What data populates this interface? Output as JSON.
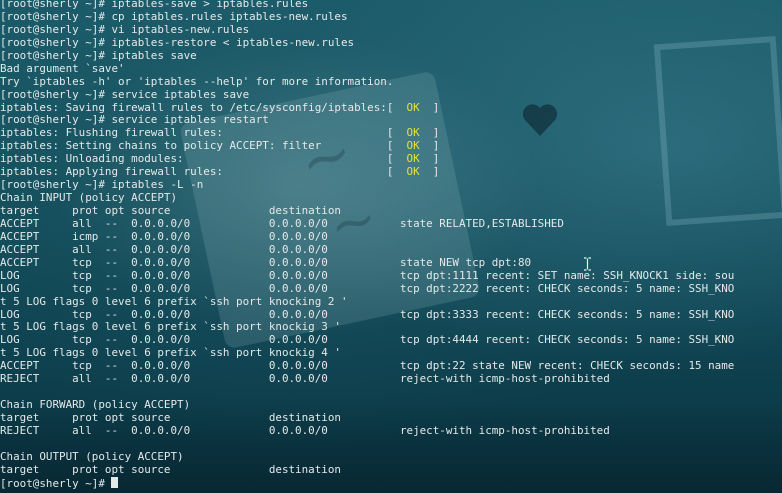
{
  "icons": {
    "text_cursor": "i-beam-cursor-icon",
    "block_cursor": "block-cursor"
  },
  "colors": {
    "ok": "#e2e23a",
    "text": "#e4e9e9"
  },
  "terminal": {
    "lines": [
      [
        {
          "t": "[root@sherly ~]# iptables-save > iptables.rules"
        }
      ],
      [
        {
          "t": "[root@sherly ~]# cp iptables.rules iptables-new.rules"
        }
      ],
      [
        {
          "t": "[root@sherly ~]# vi iptables-new.rules"
        }
      ],
      [
        {
          "t": "[root@sherly ~]# iptables-restore < iptables-new.rules"
        }
      ],
      [
        {
          "t": "[root@sherly ~]# iptables save"
        }
      ],
      [
        {
          "t": "Bad argument `save'"
        }
      ],
      [
        {
          "t": "Try `iptables -h' or 'iptables --help' for more information."
        }
      ],
      [
        {
          "t": "[root@sherly ~]# service iptables save"
        }
      ],
      [
        {
          "t": "iptables: Saving firewall rules to /etc/sysconfig/iptables:[  "
        },
        {
          "t": "OK",
          "ok": true
        },
        {
          "t": "  ]"
        }
      ],
      [
        {
          "t": "[root@sherly ~]# service iptables restart"
        }
      ],
      [
        {
          "t": "iptables: Flushing firewall rules:                         [  "
        },
        {
          "t": "OK",
          "ok": true
        },
        {
          "t": "  ]"
        }
      ],
      [
        {
          "t": "iptables: Setting chains to policy ACCEPT: filter          [  "
        },
        {
          "t": "OK",
          "ok": true
        },
        {
          "t": "  ]"
        }
      ],
      [
        {
          "t": "iptables: Unloading modules:                               [  "
        },
        {
          "t": "OK",
          "ok": true
        },
        {
          "t": "  ]"
        }
      ],
      [
        {
          "t": "iptables: Applying firewall rules:                         [  "
        },
        {
          "t": "OK",
          "ok": true
        },
        {
          "t": "  ]"
        }
      ],
      [
        {
          "t": "[root@sherly ~]# iptables -L -n"
        }
      ],
      [
        {
          "t": "Chain INPUT (policy ACCEPT)"
        }
      ],
      [
        {
          "t": "target     prot opt source               destination"
        }
      ],
      [
        {
          "t": "ACCEPT     all  --  0.0.0.0/0            0.0.0.0/0           state RELATED,ESTABLISHED"
        }
      ],
      [
        {
          "t": "ACCEPT     icmp --  0.0.0.0/0            0.0.0.0/0"
        }
      ],
      [
        {
          "t": "ACCEPT     all  --  0.0.0.0/0            0.0.0.0/0"
        }
      ],
      [
        {
          "t": "ACCEPT     tcp  --  0.0.0.0/0            0.0.0.0/0           state NEW tcp dpt:80"
        }
      ],
      [
        {
          "t": "LOG        tcp  --  0.0.0.0/0            0.0.0.0/0           tcp dpt:1111 recent: SET name: SSH_KNOCK1 side: sou"
        }
      ],
      [
        {
          "t": "LOG        tcp  --  0.0.0.0/0            0.0.0.0/0           tcp dpt:2222 recent: CHECK seconds: 5 name: SSH_KNO"
        }
      ],
      [
        {
          "t": "t 5 LOG flags 0 level 6 prefix `ssh port knocking 2 '"
        }
      ],
      [
        {
          "t": "LOG        tcp  --  0.0.0.0/0            0.0.0.0/0           tcp dpt:3333 recent: CHECK seconds: 5 name: SSH_KNO"
        }
      ],
      [
        {
          "t": "t 5 LOG flags 0 level 6 prefix `ssh port knockig 3 '"
        }
      ],
      [
        {
          "t": "LOG        tcp  --  0.0.0.0/0            0.0.0.0/0           tcp dpt:4444 recent: CHECK seconds: 5 name: SSH_KNO"
        }
      ],
      [
        {
          "t": "t 5 LOG flags 0 level 6 prefix `ssh port knockig 4 '"
        }
      ],
      [
        {
          "t": "ACCEPT     tcp  --  0.0.0.0/0            0.0.0.0/0           tcp dpt:22 state NEW recent: CHECK seconds: 15 name"
        }
      ],
      [
        {
          "t": "REJECT     all  --  0.0.0.0/0            0.0.0.0/0           reject-with icmp-host-prohibited"
        }
      ],
      [
        {
          "t": ""
        }
      ],
      [
        {
          "t": "Chain FORWARD (policy ACCEPT)"
        }
      ],
      [
        {
          "t": "target     prot opt source               destination"
        }
      ],
      [
        {
          "t": "REJECT     all  --  0.0.0.0/0            0.0.0.0/0           reject-with icmp-host-prohibited"
        }
      ],
      [
        {
          "t": ""
        }
      ],
      [
        {
          "t": "Chain OUTPUT (policy ACCEPT)"
        }
      ],
      [
        {
          "t": "target     prot opt source               destination"
        }
      ],
      [
        {
          "t": "[root@sherly ~]# "
        }
      ]
    ]
  }
}
